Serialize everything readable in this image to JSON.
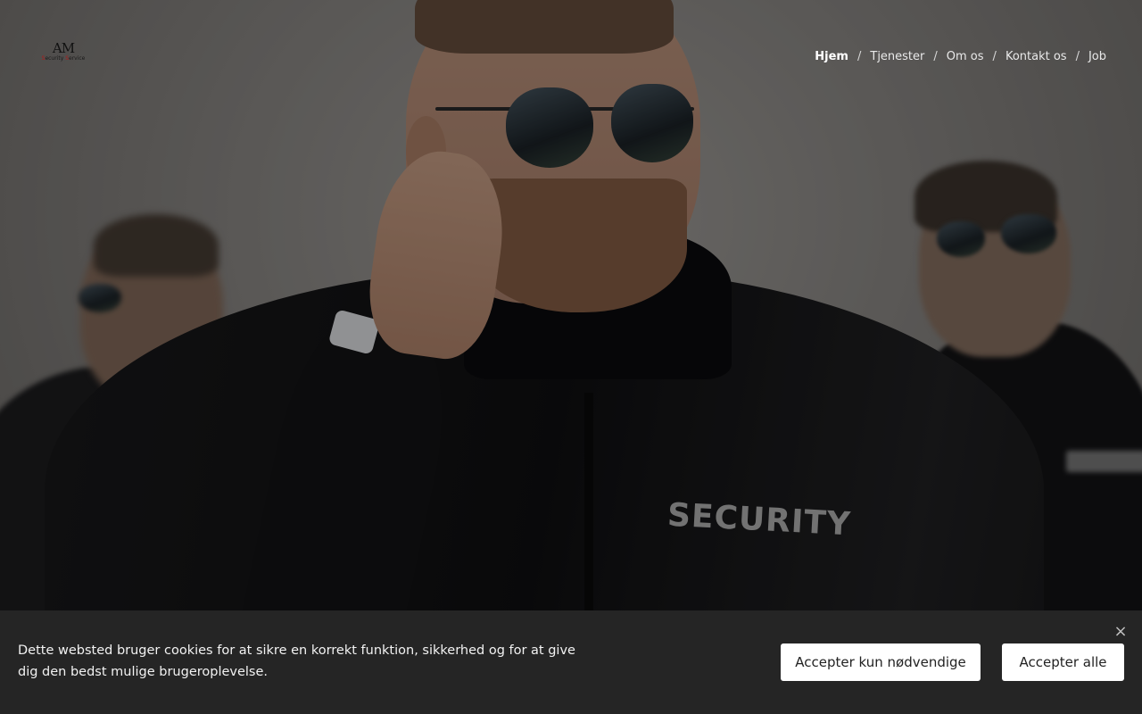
{
  "logo": {
    "mark": "AM",
    "sub_prefix": "S",
    "sub_part1": "ecurity ",
    "sub_part2": "S",
    "sub_part3": "ervice"
  },
  "nav": {
    "items": [
      {
        "label": "Hjem",
        "active": true
      },
      {
        "label": "Tjenester"
      },
      {
        "label": "Om os"
      },
      {
        "label": "Kontakt os"
      },
      {
        "label": "Job"
      }
    ],
    "separator": "/"
  },
  "hero": {
    "jacket_text": "SECURITY"
  },
  "cookie_banner": {
    "text": "Dette websted bruger cookies for at sikre en korrekt funktion, sikkerhed og for at give dig den bedst mulige brugeroplevelse.",
    "close_symbol": "×",
    "btn_necessary": "Accepter kun nødvendige",
    "btn_all": "Accepter alle"
  }
}
